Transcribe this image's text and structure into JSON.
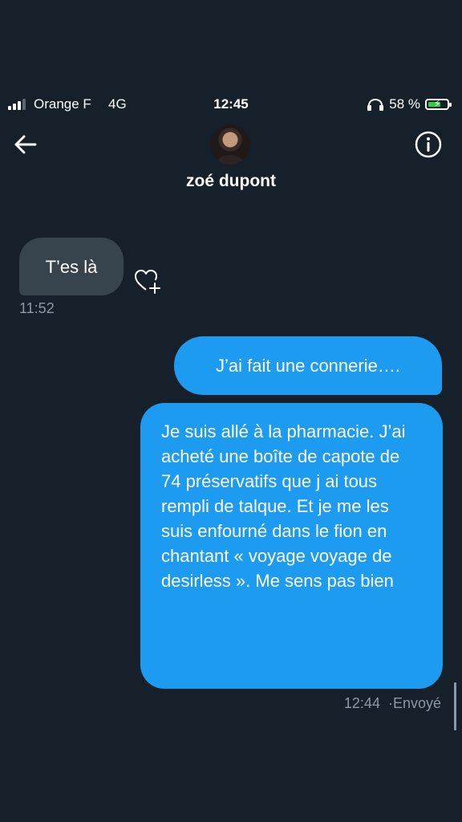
{
  "status_bar": {
    "carrier": "Orange F",
    "network": "4G",
    "time": "12:45",
    "battery": "58 %",
    "battery_level": 0.58
  },
  "header": {
    "contact_name": "zoé dupont",
    "back_icon": "arrow-left-icon",
    "info_icon": "info-circle-icon"
  },
  "messages": [
    {
      "direction": "received",
      "text": "T’es là",
      "time": "11:52"
    },
    {
      "direction": "sent",
      "text": "J’ai fait une connerie…."
    },
    {
      "direction": "sent",
      "text": "Je suis allé à la pharmacie. J’ai acheté une boîte de capote de 74 préservatifs que j ai tous rempli de talque. Et je me les suis enfourné dans le fion en chantant « voyage voyage de desirless ». Me sens pas bien",
      "time": "12:44",
      "status": "Envoyé"
    }
  ],
  "colors": {
    "background": "#15202b",
    "received_bubble": "#38444d",
    "sent_bubble": "#1d9bf0",
    "secondary_text": "#8b98a5"
  }
}
